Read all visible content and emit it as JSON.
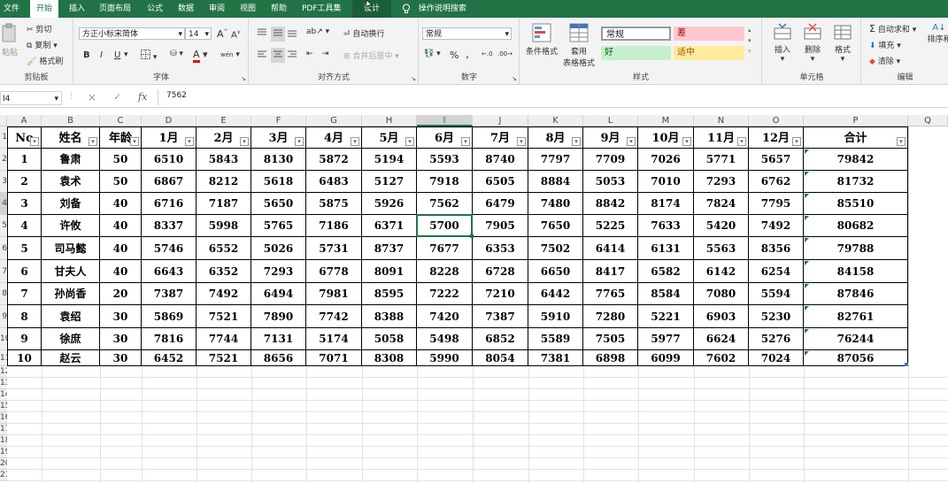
{
  "menu": {
    "tabs": [
      "文件",
      "开始",
      "插入",
      "页面布局",
      "公式",
      "数据",
      "审阅",
      "视图",
      "帮助",
      "PDF工具集",
      "设计"
    ],
    "search_label": "操作说明搜索"
  },
  "ribbon": {
    "clipboard": {
      "paste": "粘贴",
      "cut": "剪切",
      "copy": "复制",
      "format_painter": "格式刷",
      "label": "剪贴板"
    },
    "font": {
      "font_name": "方正小标宋简体",
      "font_size": "14",
      "bold": "B",
      "italic": "I",
      "underline": "U",
      "font_color_glyph": "A",
      "phonetic": "wén",
      "grow": "A",
      "shrink": "A",
      "label": "字体"
    },
    "alignment": {
      "wrap": "自动换行",
      "merge": "合并后居中",
      "label": "对齐方式"
    },
    "number": {
      "format": "常规",
      "percent": "%",
      "comma": ",",
      "label": "数字"
    },
    "styles": {
      "conditional": "条件格式",
      "table_line1": "套用",
      "table_line2": "表格格式",
      "normal": "常规",
      "bad": "差",
      "good": "好",
      "neutral": "适中",
      "label": "样式"
    },
    "cells": {
      "insert": "插入",
      "delete": "删除",
      "format": "格式",
      "label": "单元格"
    },
    "editing": {
      "autosum": "自动求和",
      "fill": "填充",
      "clear": "清除",
      "sort": "排序和",
      "label": "编辑"
    }
  },
  "formula_bar": {
    "name_box": "I4",
    "cancel": "×",
    "confirm": "✓",
    "fx": "fx",
    "value": "7562"
  },
  "colors": {
    "accent": "#217346",
    "table_border": "#000000",
    "selected_col": "#d3d3d3",
    "bad_bg": "#ffc7ce",
    "good_bg": "#c6efce",
    "neutral_bg": "#ffeb9c"
  },
  "columns": [
    "A",
    "B",
    "C",
    "D",
    "E",
    "F",
    "G",
    "H",
    "I",
    "J",
    "K",
    "L",
    "M",
    "N",
    "O",
    "P",
    "Q"
  ],
  "row_numbers": [
    "1",
    "2",
    "3",
    "4",
    "5",
    "6",
    "7",
    "8",
    "9",
    "10",
    "11",
    "12",
    "13",
    "14",
    "15",
    "16",
    "17",
    "18",
    "19",
    "20",
    "21",
    "22",
    "23"
  ],
  "table": {
    "headers": [
      "No",
      "姓名",
      "年龄",
      "1月",
      "2月",
      "3月",
      "4月",
      "5月",
      "6月",
      "7月",
      "8月",
      "9月",
      "10月",
      "11月",
      "12月",
      "合计"
    ],
    "rows": [
      [
        "1",
        "鲁肃",
        "50",
        "6510",
        "5843",
        "8130",
        "5872",
        "5194",
        "5593",
        "8740",
        "7797",
        "7709",
        "7026",
        "5771",
        "5657",
        "79842"
      ],
      [
        "2",
        "袁术",
        "50",
        "6867",
        "8212",
        "5618",
        "6483",
        "5127",
        "7918",
        "6505",
        "8884",
        "5053",
        "7010",
        "7293",
        "6762",
        "81732"
      ],
      [
        "3",
        "刘备",
        "40",
        "6716",
        "7187",
        "5650",
        "5875",
        "5926",
        "7562",
        "6479",
        "7480",
        "8842",
        "8174",
        "7824",
        "7795",
        "85510"
      ],
      [
        "4",
        "许攸",
        "40",
        "8337",
        "5998",
        "5765",
        "7186",
        "6371",
        "5700",
        "7905",
        "7650",
        "5225",
        "7633",
        "5420",
        "7492",
        "80682"
      ],
      [
        "5",
        "司马懿",
        "40",
        "5746",
        "6552",
        "5026",
        "5731",
        "8737",
        "7677",
        "6353",
        "7502",
        "6414",
        "6131",
        "5563",
        "8356",
        "79788"
      ],
      [
        "6",
        "甘夫人",
        "40",
        "6643",
        "6352",
        "7293",
        "6778",
        "8091",
        "8228",
        "6728",
        "6650",
        "8417",
        "6582",
        "6142",
        "6254",
        "84158"
      ],
      [
        "7",
        "孙尚香",
        "20",
        "7387",
        "7492",
        "6494",
        "7981",
        "8595",
        "7222",
        "7210",
        "6442",
        "7765",
        "8584",
        "7080",
        "5594",
        "87846"
      ],
      [
        "8",
        "袁绍",
        "30",
        "5869",
        "7521",
        "7890",
        "7742",
        "8388",
        "7420",
        "7387",
        "5910",
        "7280",
        "5221",
        "6903",
        "5230",
        "82761"
      ],
      [
        "9",
        "徐庶",
        "30",
        "7816",
        "7744",
        "7131",
        "5174",
        "5058",
        "5498",
        "6852",
        "5589",
        "7505",
        "5977",
        "6624",
        "5276",
        "76244"
      ],
      [
        "10",
        "赵云",
        "30",
        "6452",
        "7521",
        "8656",
        "7071",
        "8308",
        "5990",
        "8054",
        "7381",
        "6898",
        "6099",
        "7602",
        "7024",
        "87056"
      ]
    ]
  }
}
